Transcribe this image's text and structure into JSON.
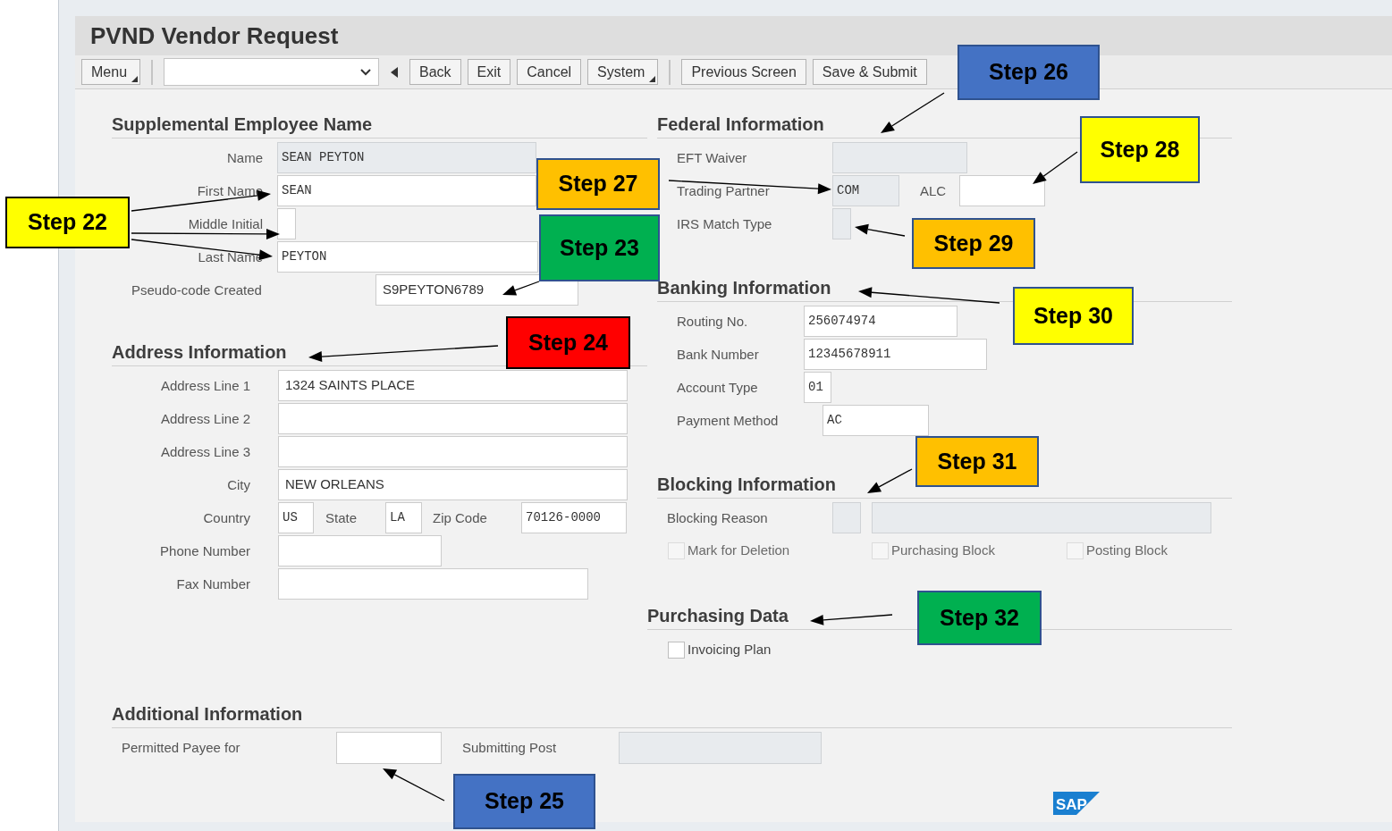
{
  "window": {
    "title": "PVND Vendor Request"
  },
  "toolbar": [
    {
      "kind": "menu",
      "label": "Menu"
    },
    {
      "kind": "separator"
    },
    {
      "kind": "select"
    },
    {
      "kind": "back_arrow"
    },
    {
      "kind": "button",
      "label": "Back"
    },
    {
      "kind": "button",
      "label": "Exit"
    },
    {
      "kind": "button",
      "label": "Cancel"
    },
    {
      "kind": "menu",
      "label": "System"
    },
    {
      "kind": "separator"
    },
    {
      "kind": "button",
      "label": "Previous Screen"
    },
    {
      "kind": "button",
      "label": "Save & Submit"
    }
  ],
  "supplemental_employee_name": {
    "heading": "Supplemental Employee Name",
    "fields": [
      {
        "label": "Name",
        "value": "SEAN  PEYTON",
        "disabled": true
      },
      {
        "label": "First Name",
        "value": "SEAN",
        "disabled": false
      },
      {
        "label": "Middle Initial",
        "disabled": false
      },
      {
        "label": "Last Name",
        "value": "PEYTON",
        "disabled": false
      },
      {
        "label": "Pseudo-code Created",
        "value": "S9PEYTON6789",
        "disabled": false
      }
    ]
  },
  "address_information": {
    "heading": "Address Information",
    "fields": [
      {
        "label": "Address Line 1",
        "value": "1324 SAINTS PLACE",
        "disabled": false
      },
      {
        "label": "Address Line 2",
        "disabled": false
      },
      {
        "label": "Address Line 3",
        "disabled": false
      },
      {
        "label": "City",
        "value": "NEW ORLEANS",
        "disabled": false
      },
      {
        "label": "Country",
        "value": "US",
        "disabled": false
      },
      {
        "label": "State",
        "value": "LA",
        "disabled": false
      },
      {
        "label": "Zip Code",
        "value": "70126-0000",
        "disabled": false
      },
      {
        "label": "Phone Number",
        "disabled": false
      },
      {
        "label": "Fax Number",
        "disabled": false
      }
    ]
  },
  "federal_information": {
    "heading": "Federal Information",
    "fields": [
      {
        "label": "EFT Waiver",
        "disabled": true
      },
      {
        "label": "Trading Partner",
        "value": "COM",
        "disabled": true
      },
      {
        "label": "ALC",
        "disabled": false
      },
      {
        "label": "IRS Match Type",
        "disabled": true
      }
    ]
  },
  "banking_information": {
    "heading": "Banking Information",
    "fields": [
      {
        "label": "Routing No.",
        "value": "256074974",
        "disabled": false
      },
      {
        "label": "Bank Number",
        "value": "12345678911",
        "disabled": false
      },
      {
        "label": "Account Type",
        "value": "01",
        "disabled": false
      },
      {
        "label": "Payment Method",
        "value": "AC",
        "disabled": false
      }
    ]
  },
  "blocking_information": {
    "heading": "Blocking Information",
    "fields": [
      {
        "label": "Blocking Reason",
        "disabled": true
      },
      {
        "disabled": true
      }
    ],
    "checkboxes": [
      {
        "label": "Mark for Deletion",
        "checked": false,
        "disabled": true
      },
      {
        "label": "Purchasing Block",
        "checked": false,
        "disabled": true
      },
      {
        "label": "Posting Block",
        "checked": false,
        "disabled": true
      }
    ]
  },
  "purchasing_data": {
    "heading": "Purchasing Data",
    "checkboxes": [
      {
        "label": "Invoicing Plan",
        "checked": false,
        "disabled": false
      }
    ]
  },
  "additional_information": {
    "heading": "Additional Information",
    "fields": [
      {
        "label": "Permitted Payee for",
        "disabled": false
      },
      {
        "label": "Submitting Post",
        "disabled": true
      }
    ]
  },
  "logo": "SAP",
  "annotations": [
    {
      "label": "Step 26",
      "color": "#4472c4"
    },
    {
      "label": "Step 27",
      "color": "#ffc000"
    },
    {
      "label": "Step 28",
      "color": "#ffff00"
    },
    {
      "label": "Step 22",
      "color": "#ffff00"
    },
    {
      "label": "Step 23",
      "color": "#00b050"
    },
    {
      "label": "Step 29",
      "color": "#ffc000"
    },
    {
      "label": "Step 30",
      "color": "#ffff00"
    },
    {
      "label": "Step 24",
      "color": "#ff0000"
    },
    {
      "label": "Step 31",
      "color": "#ffc000"
    },
    {
      "label": "Step 32",
      "color": "#00b050"
    },
    {
      "label": "Step 25",
      "color": "#4472c4"
    }
  ]
}
